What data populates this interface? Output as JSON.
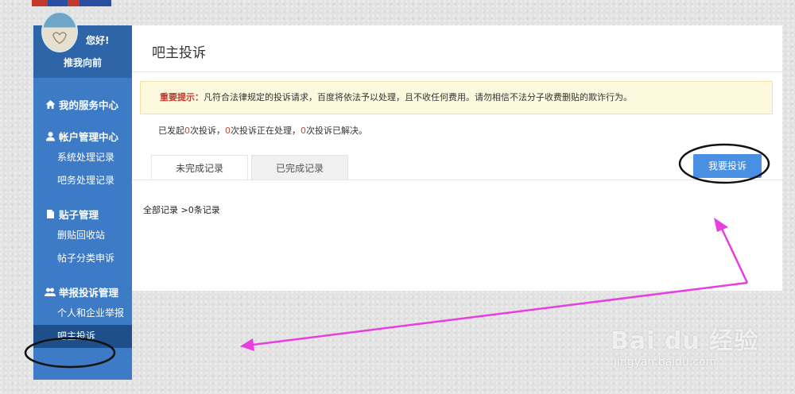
{
  "sidebar": {
    "greeting": "您好!",
    "username": "推我向前",
    "groups": [
      {
        "title": "我的服务中心",
        "icon": "home-icon",
        "items": []
      },
      {
        "title": "帐户管理中心",
        "icon": "user-icon",
        "items": [
          "系统处理记录",
          "吧务处理记录"
        ]
      },
      {
        "title": "贴子管理",
        "icon": "document-icon",
        "items": [
          "删贴回收站",
          "帖子分类申诉"
        ]
      },
      {
        "title": "举报投诉管理",
        "icon": "users-icon",
        "items": [
          "个人和企业举报",
          "吧主投诉"
        ]
      }
    ]
  },
  "main": {
    "title": "吧主投诉",
    "notice": {
      "tip_label": "重要提示：",
      "text": "凡符合法律规定的投诉请求，百度将依法予以处理，且不收任何费用。请勿相信不法分子收费删贴的欺诈行为。"
    },
    "stats": {
      "part1": "已发起",
      "n1": "0",
      "part2": "次投诉，",
      "n2": "0",
      "part3": "次投诉正在处理，",
      "n3": "0",
      "part4": "次投诉已解决。"
    },
    "tabs": [
      "未完成记录",
      "已完成记录"
    ],
    "complain_button": "我要投诉",
    "records": "全部记录 >0条记录"
  },
  "watermark": {
    "brand": "Bai du 经验",
    "url": "jingyan.baidu.com"
  },
  "colors": {
    "sidebar": "#3d7bc6",
    "sidebar_active": "#1f4f8a",
    "button": "#4a90e2",
    "annotation_arrow": "#e83ee0",
    "highlight_number": "#d04437"
  }
}
